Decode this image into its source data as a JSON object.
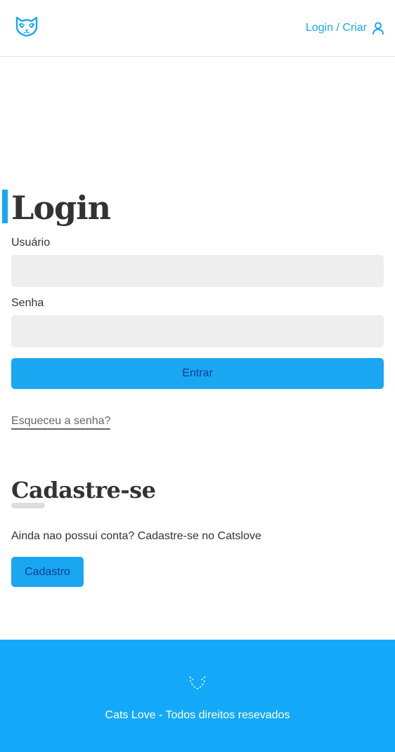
{
  "header": {
    "logo_icon": "cat-face-logo",
    "login_label": "Login / Criar",
    "user_icon": "user-icon"
  },
  "login": {
    "title": "Login",
    "username_label": "Usuário",
    "username_value": "",
    "password_label": "Senha",
    "password_value": "",
    "submit_label": "Entrar",
    "forgot_label": "Esqueceu a senha?"
  },
  "signup": {
    "title": "Cadastre-se",
    "text": "Ainda nao possui conta? Cadastre-se no Catslove",
    "button_label": "Cadastro"
  },
  "footer": {
    "logo_icon": "cat-face-outline-logo",
    "text": "Cats Love - Todos direitos resevados"
  },
  "colors": {
    "accent": "#1aa7f2",
    "footer_bg": "#14a9f8",
    "input_bg": "#eeeeee",
    "button_text": "#0b3f8f"
  }
}
